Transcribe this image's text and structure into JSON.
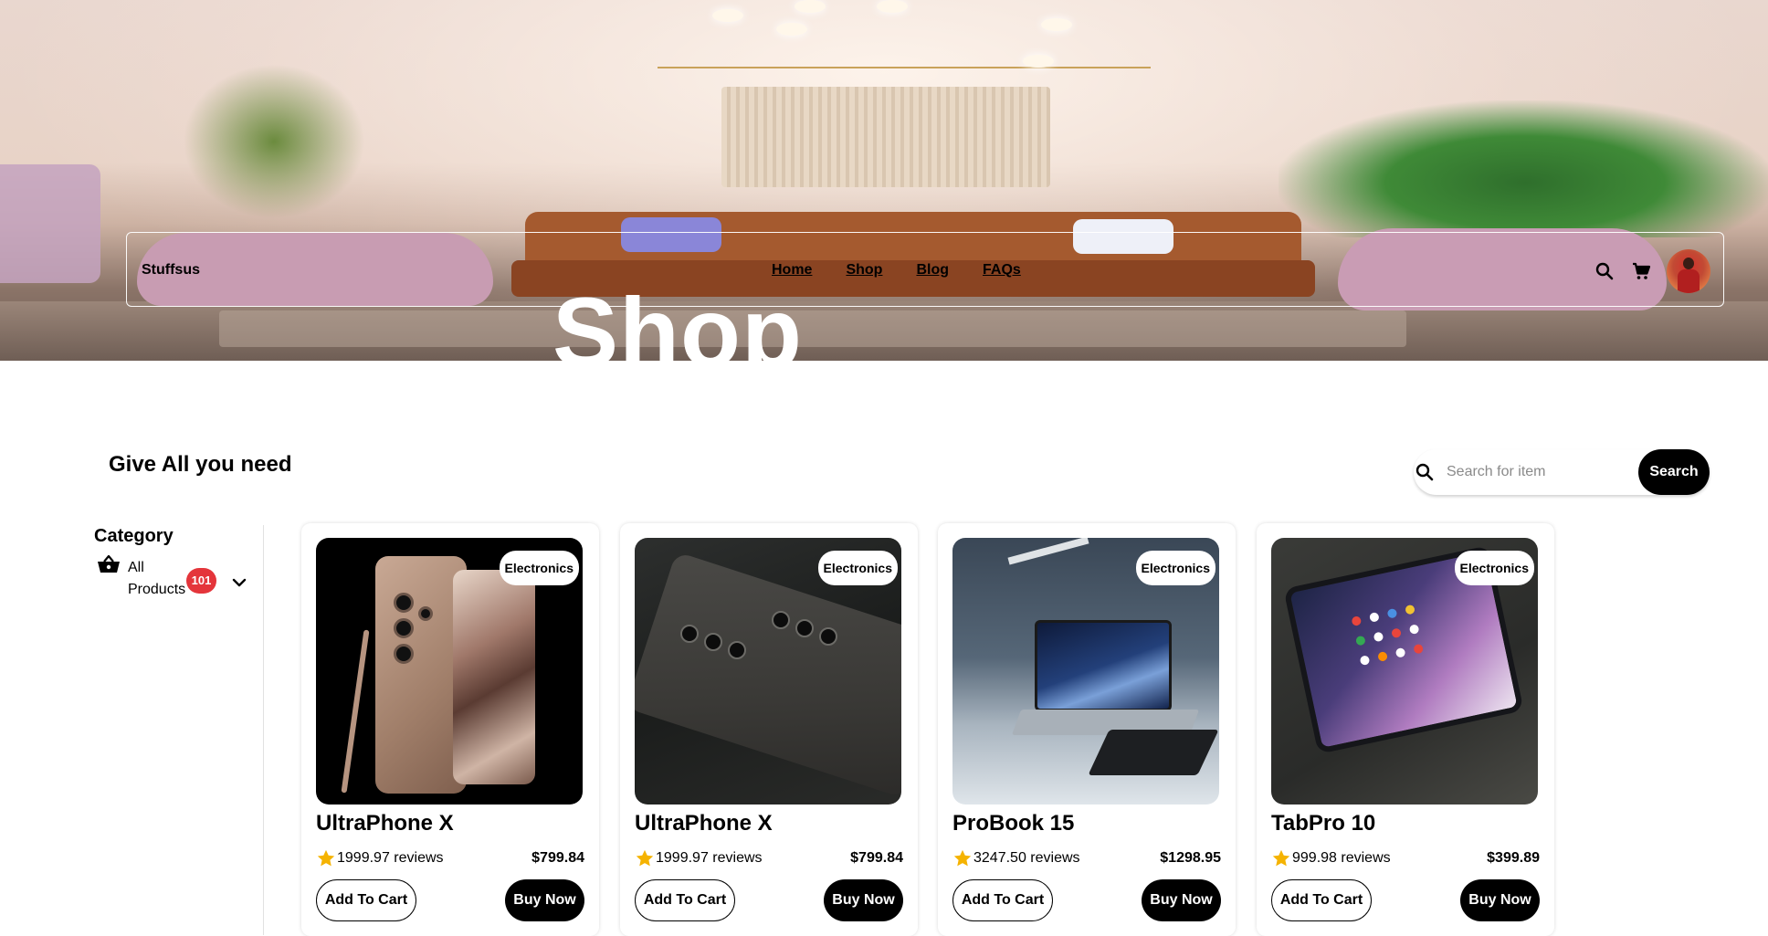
{
  "hero": {
    "title": "Shop"
  },
  "navbar": {
    "brand": "Stuffsus",
    "links": [
      "Home",
      "Shop",
      "Blog",
      "FAQs"
    ]
  },
  "main": {
    "tagline": "Give All you need",
    "search": {
      "placeholder": "Search for item",
      "button_label": "Search"
    }
  },
  "sidebar": {
    "title": "Category",
    "items": [
      {
        "label": "All Products",
        "count": "101",
        "icon": "basket-icon"
      }
    ]
  },
  "products": [
    {
      "category": "Electronics",
      "name": "UltraPhone X",
      "rating_text": "1999.97 reviews",
      "price": "$799.84",
      "add_label": "Add To Cart",
      "buy_label": "Buy Now"
    },
    {
      "category": "Electronics",
      "name": "UltraPhone X",
      "rating_text": "1999.97 reviews",
      "price": "$799.84",
      "add_label": "Add To Cart",
      "buy_label": "Buy Now"
    },
    {
      "category": "Electronics",
      "name": "ProBook 15",
      "rating_text": "3247.50 reviews",
      "price": "$1298.95",
      "add_label": "Add To Cart",
      "buy_label": "Buy Now"
    },
    {
      "category": "Electronics",
      "name": "TabPro 10",
      "rating_text": "999.98 reviews",
      "price": "$399.89",
      "add_label": "Add To Cart",
      "buy_label": "Buy Now"
    }
  ],
  "colors": {
    "primary": "#000000",
    "badge": "#e4353b",
    "star": "#f5b301"
  },
  "icons": [
    "search-icon",
    "cart-icon",
    "basket-icon",
    "chevron-down-icon",
    "star-icon"
  ]
}
